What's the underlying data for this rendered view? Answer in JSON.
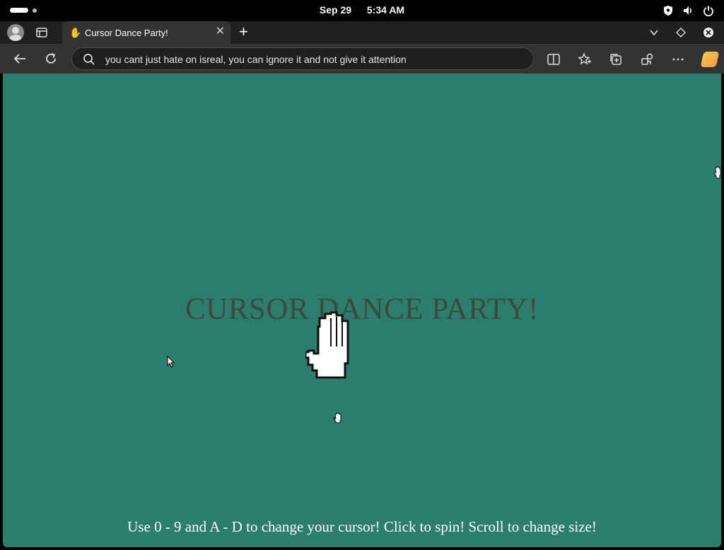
{
  "status_bar": {
    "date": "Sep 29",
    "time": "5:34 AM",
    "icons": [
      "shield-icon",
      "volume-icon",
      "power-icon"
    ]
  },
  "tab_bar": {
    "active_tab": {
      "title": "Cursor Dance Party!",
      "favicon": "hand-cursor-icon",
      "close_symbol": "✕"
    },
    "new_tab_symbol": "+",
    "icons": [
      "profile-avatar",
      "tab-actions-icon",
      "tab-list-chevron-icon",
      "diamond-icon",
      "window-close-icon"
    ]
  },
  "nav_bar": {
    "address_text": "you cant just hate on isreal, you can ignore it and not give it attention",
    "icons": [
      "back-arrow-icon",
      "reload-icon",
      "search-icon",
      "split-screen-icon",
      "favorites-icon",
      "collections-icon",
      "extensions-icon",
      "more-icon",
      "copilot-icon"
    ]
  },
  "page": {
    "title": "CURSOR DANCE PARTY!",
    "instructions": "Use 0 - 9 and A - D to change your cursor! Click to spin! Scroll to change size!",
    "background_color": "#2c7d6e",
    "title_color": "#3b4a3a",
    "cursors": [
      "large-hand-cursor",
      "small-hand-cursor",
      "arrow-cursor",
      "edge-hand-cursor"
    ]
  }
}
